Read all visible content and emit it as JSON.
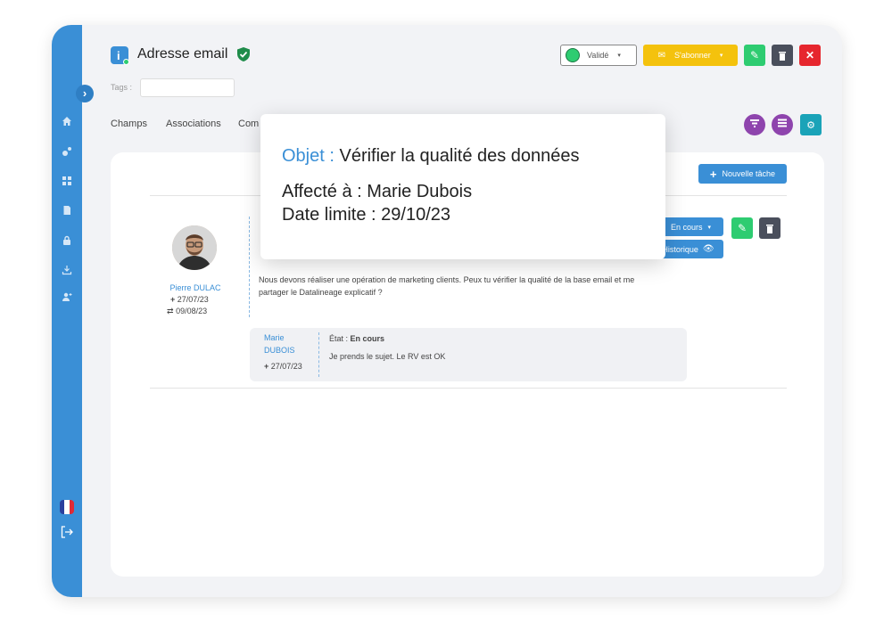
{
  "header": {
    "title": "Adresse email",
    "tags_label": "Tags :",
    "tags_value": "",
    "status_select": "Validé",
    "subscribe_label": "S'abonner"
  },
  "tabs": [
    "Champs",
    "Associations",
    "Com"
  ],
  "toolbar": {
    "new_task_label": "Nouvelle tâche",
    "status_dropdown": "En cours",
    "history_label": "Historique"
  },
  "task": {
    "author": "Pierre DULAC",
    "created": "27/07/23",
    "updated": "09/08/23",
    "message": "Nous devons réaliser une opération de marketing clients. Peux tu vérifier la qualité de la base email et me partager le Datalineage explicatif ?"
  },
  "reply": {
    "author_line1": "Marie",
    "author_line2": "DUBOIS",
    "date": "27/07/23",
    "state_label": "État : ",
    "state_value": "En cours",
    "message": "Je prends le sujet. Le RV est OK"
  },
  "tooltip": {
    "object_label": "Objet :",
    "object_value": "Vérifier la qualité des données",
    "assigned_label": "Affecté à :",
    "assigned_value": "Marie Dubois",
    "deadline_label": "Date limite :",
    "deadline_value": "29/10/23"
  },
  "colors": {
    "sidebar": "#3a8fd6",
    "accent_blue": "#3a8fd6",
    "subscribe_yellow": "#f4c20d",
    "edit_green": "#2ecc71",
    "delete_dark": "#4a4f5c",
    "close_red": "#e6262e",
    "purple": "#8e44ad",
    "teal": "#1aa3b8"
  },
  "icons": [
    "home-icon",
    "share-icon",
    "grid-icon",
    "document-icon",
    "lock-icon",
    "download-icon",
    "user-add-icon",
    "logout-icon",
    "shield-check-icon",
    "info-icon",
    "envelope-icon",
    "edit-icon",
    "trash-icon",
    "close-icon",
    "filter-icon",
    "list-icon",
    "settings-icon",
    "plus-icon",
    "eye-icon"
  ]
}
